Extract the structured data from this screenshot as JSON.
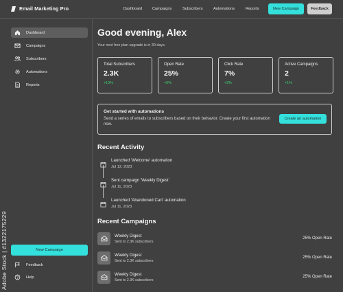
{
  "app": {
    "title": "Email Marketing Pro"
  },
  "topnav": {
    "links": [
      "Dashboard",
      "Campaigns",
      "Subscribers",
      "Automations",
      "Reports"
    ],
    "new_campaign": "New Campaign",
    "feedback": "Feedback"
  },
  "sidebar": {
    "items": [
      {
        "label": "Dashboard",
        "icon": "home-icon"
      },
      {
        "label": "Campaigns",
        "icon": "mail-icon"
      },
      {
        "label": "Subscribers",
        "icon": "users-icon"
      },
      {
        "label": "Automations",
        "icon": "gear-icon"
      },
      {
        "label": "Reports",
        "icon": "document-icon"
      }
    ],
    "new_campaign": "New Campaign",
    "feedback": "Feedback",
    "help": "Help"
  },
  "main": {
    "greeting": "Good evening, Alex",
    "subtitle": "Your next free plan upgrade is in 30 days.",
    "stats": [
      {
        "label": "Total Subscribers",
        "value": "2.3K",
        "change": "+10%"
      },
      {
        "label": "Open Rate",
        "value": "25%",
        "change": "+5%"
      },
      {
        "label": "Click Rate",
        "value": "7%",
        "change": "+3%"
      },
      {
        "label": "Active Campaigns",
        "value": "2",
        "change": "+1%"
      }
    ],
    "automation": {
      "title": "Get started with automations",
      "description": "Send a series of emails to subscribers based on their behavior. Create your first automation now.",
      "button": "Create an automation"
    },
    "recent_activity": {
      "title": "Recent Activity",
      "items": [
        {
          "title": "Launched 'Welcome' automation",
          "date": "Jul 12, 2023"
        },
        {
          "title": "Sent campaign 'Weekly Digest'",
          "date": "Jul 11, 2023"
        },
        {
          "title": "Launched 'Abandoned Cart' automation",
          "date": "Jul 11, 2023"
        }
      ]
    },
    "recent_campaigns": {
      "title": "Recent Campaigns",
      "items": [
        {
          "name": "Weekly Digest",
          "meta": "Sent to 2.3K subscribers",
          "rate": "25% Open Rate"
        },
        {
          "name": "Weekly Digest",
          "meta": "Sent to 2.3K subscribers",
          "rate": "25% Open Rate"
        },
        {
          "name": "Weekly Digest",
          "meta": "Sent to 2.3K subscribers",
          "rate": "25% Open Rate"
        }
      ]
    }
  },
  "watermark": "Adobe Stock | #1322175229",
  "colors": {
    "accent": "#33e0dc",
    "positive": "#39d56f",
    "background": "#404040"
  }
}
